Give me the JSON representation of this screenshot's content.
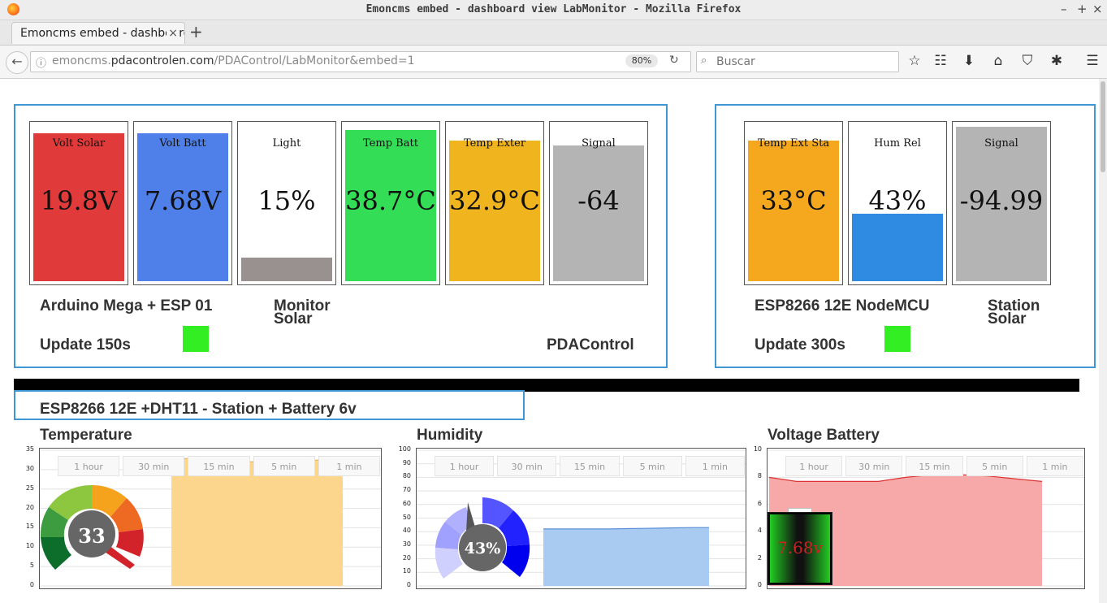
{
  "window": {
    "title": "Emoncms embed - dashboard view LabMonitor - Mozilla Firefox"
  },
  "tab": {
    "label": "Emoncms embed - dashboard view LabMonitor"
  },
  "nav": {
    "url_prefix": "emoncms.",
    "url_domain": "pdacontrolen.com",
    "url_path": "/PDAControl/LabMonitor&embed=1",
    "zoom": "80%",
    "search_placeholder": "Buscar"
  },
  "colors": {
    "panel_border": "#3f97d3",
    "status_green": "#33ee22"
  },
  "panel1": {
    "tiles": [
      {
        "label": "Volt Solar",
        "value": "19.8V",
        "color": "#e03a3a",
        "level": 0.95
      },
      {
        "label": "Volt Batt",
        "value": "7.68V",
        "color": "#4f7fe8",
        "level": 0.95
      },
      {
        "label": "Light",
        "value": "15%",
        "color": "#999090",
        "level": 0.15
      },
      {
        "label": "Temp Batt",
        "value": "38.7°C",
        "color": "#33dd55",
        "level": 0.97
      },
      {
        "label": "Temp Exter",
        "value": "32.9°C",
        "color": "#f0b41e",
        "level": 0.9
      },
      {
        "label": "Signal",
        "value": "-64",
        "color": "#b4b4b4",
        "level": 0.87
      }
    ],
    "device": "Arduino Mega + ESP 01",
    "monitor_line1": "Monitor",
    "monitor_line2": "Solar",
    "update": "Update 150s",
    "brand": "PDAControl"
  },
  "panel2": {
    "tiles": [
      {
        "label": "Temp Ext Sta",
        "value": "33°C",
        "color": "#f5a81e",
        "level": 0.9
      },
      {
        "label": "Hum Rel",
        "value": "43%",
        "color": "#2f8be2",
        "level": 0.43
      },
      {
        "label": "Signal",
        "value": "-94.99",
        "color": "#b4b4b4",
        "level": 0.99
      }
    ],
    "device": "ESP8266 12E NodeMCU",
    "station_line1": "Station",
    "station_line2": "Solar",
    "update": "Update 300s"
  },
  "section": {
    "title": "ESP8266 12E +DHT11 - Station + Battery 6v"
  },
  "ranges": [
    "1 hour",
    "30 min",
    "15 min",
    "5 min",
    "1 min"
  ],
  "gauges": {
    "temperature": "33",
    "humidity": "43%",
    "battery": "7.68v"
  },
  "chart_data": [
    {
      "type": "area",
      "title": "Temperature",
      "ylim": [
        0,
        35
      ],
      "yticks": [
        0,
        5,
        10,
        15,
        20,
        25,
        30,
        35
      ],
      "x": [
        0,
        1,
        2,
        3,
        4,
        5,
        6,
        7,
        8,
        9,
        10
      ],
      "values": [
        33,
        32.8,
        32.6,
        32.3,
        32.1,
        32,
        32,
        32.1,
        32.3,
        32.6,
        32.9
      ],
      "color": "#fbd68c"
    },
    {
      "type": "area",
      "title": "Humidity",
      "ylim": [
        0,
        100
      ],
      "yticks": [
        0,
        10,
        20,
        30,
        40,
        50,
        60,
        70,
        80,
        90,
        100
      ],
      "x": [
        0,
        1,
        2,
        3,
        4,
        5,
        6,
        7,
        8,
        9,
        10
      ],
      "values": [
        42,
        42,
        42,
        42,
        42,
        42.2,
        42.4,
        42.6,
        42.8,
        43,
        43
      ],
      "color": "#a9cbf2"
    },
    {
      "type": "area",
      "title": "Voltage Battery",
      "ylim": [
        0,
        10
      ],
      "yticks": [
        0,
        2,
        4,
        6,
        8,
        10
      ],
      "x": [
        0,
        1,
        2,
        3,
        4,
        5,
        6,
        7,
        8,
        9,
        10
      ],
      "values": [
        8,
        7.7,
        7.7,
        7.7,
        7.7,
        8,
        8.2,
        8.2,
        8.1,
        7.9,
        7.7
      ],
      "color": "#f7a8a8"
    }
  ]
}
